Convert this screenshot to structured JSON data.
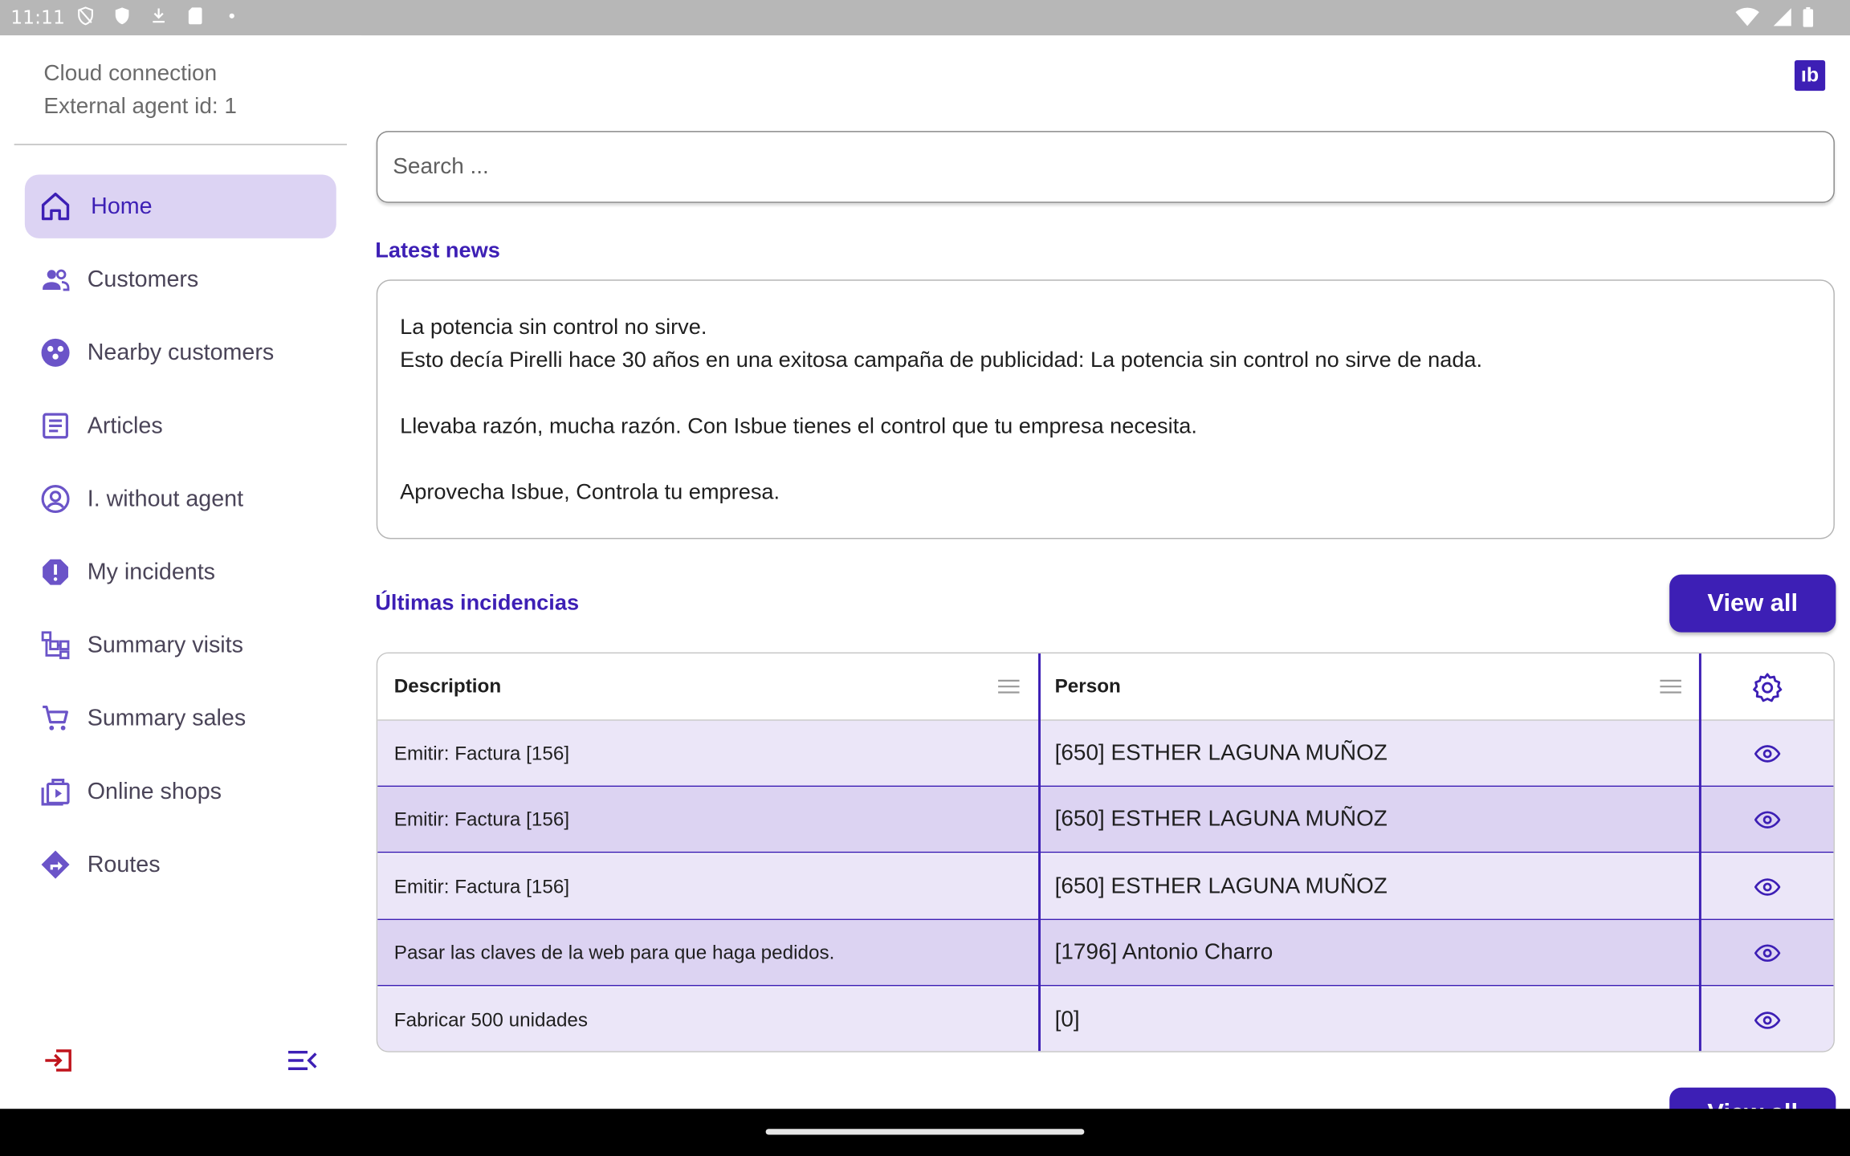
{
  "status_bar": {
    "time": "11:11"
  },
  "sidebar": {
    "header_line1": "Cloud connection",
    "header_line2": "External agent id: 1",
    "items": [
      {
        "label": "Home",
        "icon": "home-icon",
        "active": true
      },
      {
        "label": "Customers",
        "icon": "people-icon"
      },
      {
        "label": "Nearby customers",
        "icon": "nearby-icon"
      },
      {
        "label": "Articles",
        "icon": "article-icon"
      },
      {
        "label": "I. without agent",
        "icon": "account-circle-icon"
      },
      {
        "label": "My incidents",
        "icon": "alert-octagon-icon"
      },
      {
        "label": "Summary visits",
        "icon": "hierarchy-icon"
      },
      {
        "label": "Summary sales",
        "icon": "cart-icon"
      },
      {
        "label": "Online shops",
        "icon": "shop-icon"
      },
      {
        "label": "Routes",
        "icon": "directions-icon"
      }
    ]
  },
  "header": {
    "logo_text": "ıb"
  },
  "search": {
    "placeholder": "Search ..."
  },
  "news": {
    "title": "Latest news",
    "lines": [
      "La potencia sin control no sirve.",
      "Esto decía Pirelli hace 30 años en una exitosa campaña de publicidad: La potencia sin control no sirve de nada.",
      "",
      "Llevaba razón, mucha razón. Con Isbue tienes el control que tu empresa necesita.",
      "",
      "Aprovecha Isbue, Controla tu empresa."
    ]
  },
  "incidents": {
    "title": "Últimas incidencias",
    "view_all_label": "View all",
    "columns": [
      "Description",
      "Person"
    ],
    "rows": [
      {
        "description": "Emitir: Factura [156]",
        "person": "[650] ESTHER LAGUNA MUÑOZ"
      },
      {
        "description": "Emitir: Factura [156]",
        "person": "[650] ESTHER LAGUNA MUÑOZ"
      },
      {
        "description": "Emitir: Factura [156]",
        "person": "[650] ESTHER LAGUNA MUÑOZ"
      },
      {
        "description": "Pasar las claves de la web para que haga pedidos.",
        "person": "[1796] Antonio Charro"
      },
      {
        "description": "Fabricar 500 unidades",
        "person": "[0]"
      }
    ]
  },
  "next_section": {
    "view_all_label": "View all"
  },
  "colors": {
    "primary": "#3d1fb5",
    "active_bg": "#dcd3f3",
    "row_odd": "#ebe6f8",
    "row_even": "#dcd3f2",
    "logout": "#c0141c"
  }
}
